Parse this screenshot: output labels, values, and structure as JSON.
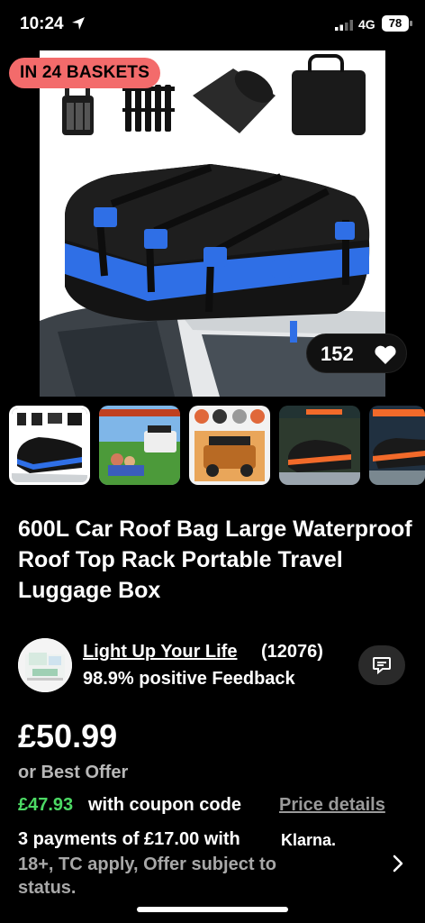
{
  "status_bar": {
    "time": "10:24",
    "network": "4G",
    "battery": "78",
    "icons": [
      "location-arrow-icon",
      "signal-bars-icon",
      "battery-icon"
    ]
  },
  "hero": {
    "badge": "IN 24 BASKETS",
    "watch_count": "152",
    "icons": [
      "heart-icon"
    ]
  },
  "thumbnails": [
    {
      "label": "thumbnail-1",
      "selected": true
    },
    {
      "label": "thumbnail-2",
      "selected": false
    },
    {
      "label": "thumbnail-3",
      "selected": false
    },
    {
      "label": "thumbnail-4",
      "selected": false
    },
    {
      "label": "thumbnail-5",
      "selected": false
    }
  ],
  "product": {
    "title": "600L Car Roof Bag Large Waterproof Roof Top Rack Portable Travel Luggage Box"
  },
  "seller": {
    "name": "Light Up Your Life",
    "count": "(12076)",
    "feedback": "98.9% positive Feedback",
    "icons": [
      "message-icon"
    ]
  },
  "pricing": {
    "price": "£50.99",
    "best_offer": "or Best Offer",
    "coupon_price": "£47.93",
    "coupon_text": "with coupon code",
    "price_details": "Price details"
  },
  "payments": {
    "line": "3 payments of £17.00 with",
    "provider": "Klarna.",
    "sub": "18+, TC apply, Offer subject to status.",
    "icons": [
      "chevron-right-icon"
    ]
  },
  "colors": {
    "background": "#000000",
    "badge": "#f36b6b",
    "coupon_green": "#4cd964",
    "bag_blue": "#2f6fe6"
  }
}
